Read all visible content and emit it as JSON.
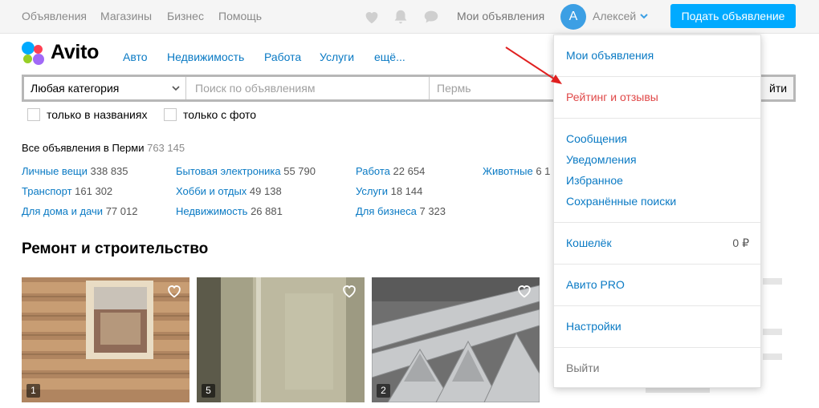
{
  "topnav": {
    "links": [
      "Объявления",
      "Магазины",
      "Бизнес",
      "Помощь"
    ],
    "my_ads": "Мои объявления",
    "avatar_letter": "А",
    "user_name": "Алексей",
    "post_button": "Подать объявление"
  },
  "logo": {
    "text": "Avito",
    "dot_colors": [
      "#00aaff",
      "#ff4053",
      "#97cf26",
      "#a169f7"
    ]
  },
  "categories": [
    "Авто",
    "Недвижимость",
    "Работа",
    "Услуги",
    "ещё..."
  ],
  "search": {
    "category": "Любая категория",
    "query_placeholder": "Поиск по объявлениям",
    "city": "Пермь",
    "button_partial": "йти"
  },
  "filters": {
    "titles_only": "только в названиях",
    "with_photo": "только с фото"
  },
  "stats": {
    "label": "Все объявления в Перми",
    "total": "763 145",
    "items": [
      {
        "name": "Личные вещи",
        "count": "338 835"
      },
      {
        "name": "Транспорт",
        "count": "161 302"
      },
      {
        "name": "Для дома и дачи",
        "count": "77 012"
      },
      {
        "name": "Бытовая электроника",
        "count": "55 790"
      },
      {
        "name": "Хобби и отдых",
        "count": "49 138"
      },
      {
        "name": "Недвижимость",
        "count": "26 881"
      },
      {
        "name": "Работа",
        "count": "22 654"
      },
      {
        "name": "Услуги",
        "count": "18 144"
      },
      {
        "name": "Для бизнеса",
        "count": "7 323"
      },
      {
        "name": "Животные",
        "count": "6 1"
      }
    ]
  },
  "section_title": "Ремонт и строительство",
  "cards": [
    {
      "photo_count": "1"
    },
    {
      "photo_count": "5"
    },
    {
      "photo_count": "2"
    }
  ],
  "dropdown": {
    "my_ads": "Мои объявления",
    "rating": "Рейтинг и отзывы",
    "messages": "Сообщения",
    "notifications": "Уведомления",
    "favorites": "Избранное",
    "saved_searches": "Сохранённые поиски",
    "wallet": "Кошелёк",
    "wallet_amount": "0 ₽",
    "pro": "Авито PRO",
    "settings": "Настройки",
    "logout": "Выйти"
  },
  "colors": {
    "accent": "#00aaff",
    "link": "#0a7ac4",
    "rating_red": "#e04848",
    "annotation_arrow": "#e02020"
  }
}
